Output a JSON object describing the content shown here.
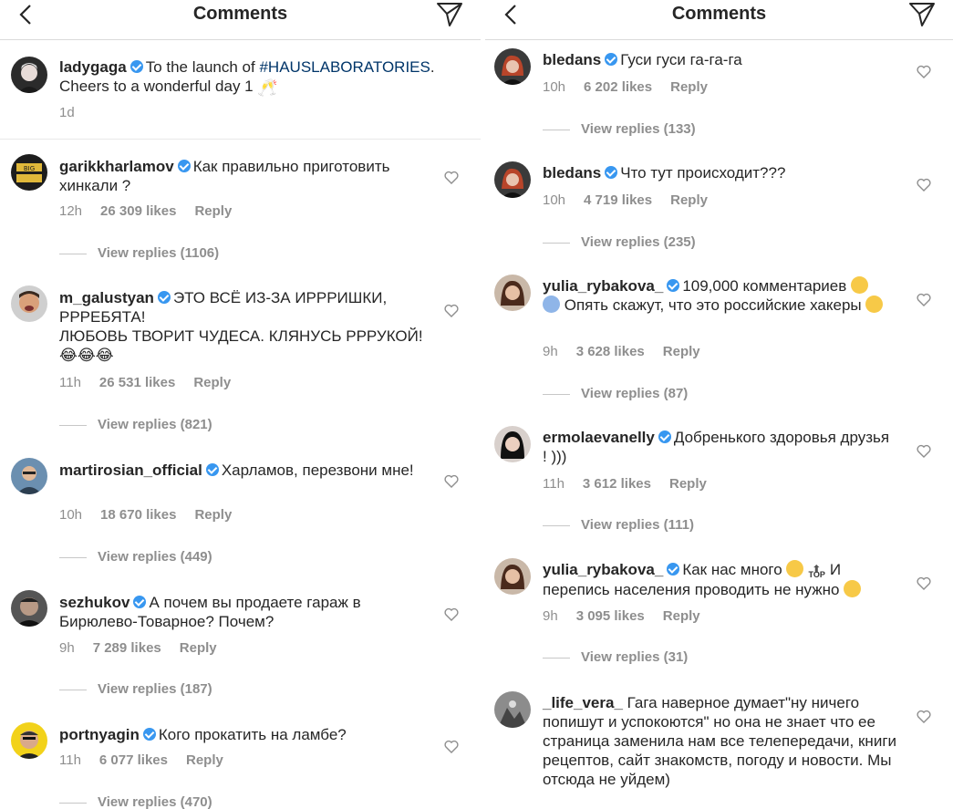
{
  "left": {
    "header": {
      "title": "Comments"
    },
    "caption": {
      "username": "ladygaga",
      "text_before": "To the launch of ",
      "hashtag": "#HAUSLABORATORIES",
      "text_after": ". Cheers to a wonderful day 1 ",
      "emoji": "🥂",
      "time": "1d"
    },
    "comments": [
      {
        "username": "garikkharlamov",
        "text": "Как правильно приготовить хинкали ?",
        "time": "12h",
        "likes": "26 309 likes",
        "reply": "Reply",
        "view_replies": "View replies (1106)"
      },
      {
        "username": "m_galustyan",
        "text": "ЭТО ВСЁ ИЗ-ЗА ИРРРИШКИ, РРРЕБЯТА!",
        "text2": "ЛЮБОВЬ ТВОРИТ ЧУДЕСА. КЛЯНУСЬ РРРУКОЙ!",
        "emoji": "😂😂😂",
        "time": "11h",
        "likes": "26 531 likes",
        "reply": "Reply",
        "view_replies": "View replies (821)"
      },
      {
        "username": "martirosian_official",
        "text": "Харламов, перезвони мне!",
        "time": "10h",
        "likes": "18 670 likes",
        "reply": "Reply",
        "view_replies": "View replies (449)"
      },
      {
        "username": "sezhukov",
        "text": "А почем вы продаете гараж в Бирюлево-Товарное? Почем?",
        "time": "9h",
        "likes": "7 289 likes",
        "reply": "Reply",
        "view_replies": "View replies (187)"
      },
      {
        "username": "portnyagin",
        "text": "Кого прокатить на ламбе?",
        "time": "11h",
        "likes": "6 077 likes",
        "reply": "Reply",
        "view_replies": "View replies (470)"
      }
    ]
  },
  "right": {
    "header": {
      "title": "Comments"
    },
    "comments": [
      {
        "username": "bledans",
        "text": "Гуси гуси га-га-га",
        "time": "10h",
        "likes": "6 202 likes",
        "reply": "Reply",
        "view_replies": "View replies (133)"
      },
      {
        "username": "bledans",
        "text": "Что тут происходит???",
        "time": "10h",
        "likes": "4 719 likes",
        "reply": "Reply",
        "view_replies": "View replies (235)"
      },
      {
        "username": "yulia_rybakova_",
        "text": "109,000 комментариев",
        "text2": "Опять скажут, что это российские хакеры",
        "time": "9h",
        "likes": "3 628 likes",
        "reply": "Reply",
        "view_replies": "View replies (87)"
      },
      {
        "username": "ermolaevanelly",
        "text": "Добренького здоровья друзья ! )))",
        "time": "11h",
        "likes": "3 612 likes",
        "reply": "Reply",
        "view_replies": "View replies (111)"
      },
      {
        "username": "yulia_rybakova_",
        "text": "Как нас много",
        "text2": "И перепись населения проводить не нужно",
        "emoji_top": "TOP",
        "time": "9h",
        "likes": "3 095 likes",
        "reply": "Reply",
        "view_replies": "View replies (31)"
      },
      {
        "username": "_life_vera_",
        "text": "Гага наверное думает\"ну ничего попишут и успокоются\" но она не знает что ее страница заменила нам все телепередачи, книги рецептов, сайт знакомств, погоду и новости. Мы отсюда не уйдем)"
      }
    ]
  },
  "colors": {
    "verified": "#3897f0",
    "hashtag": "#003569",
    "meta": "#8e8e8e",
    "text": "#262626"
  }
}
